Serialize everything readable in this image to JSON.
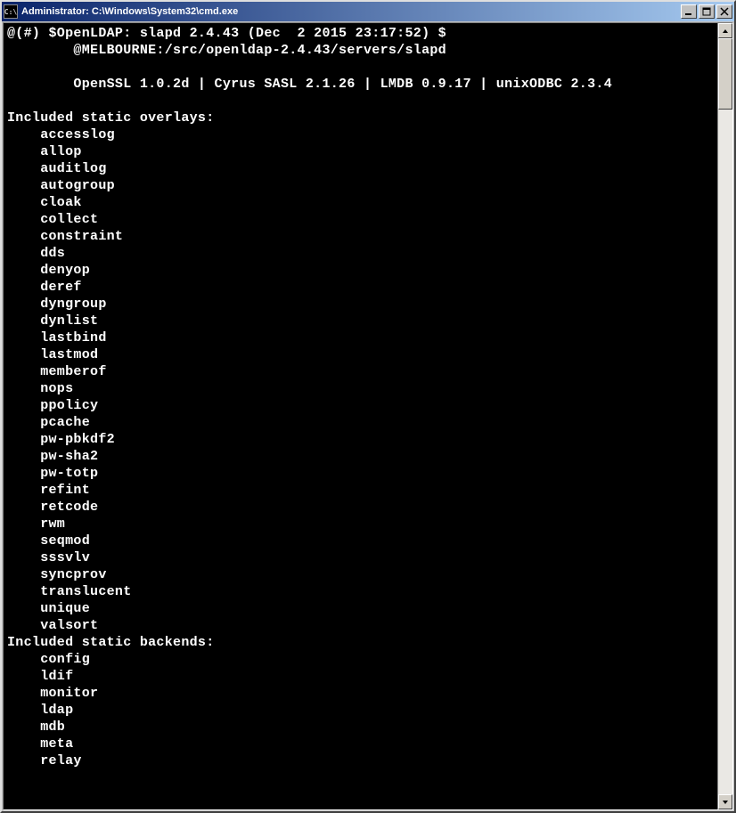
{
  "window": {
    "title": "Administrator: C:\\Windows\\System32\\cmd.exe",
    "icon_label": "C:\\"
  },
  "terminal": {
    "line1": "@(#) $OpenLDAP: slapd 2.4.43 (Dec  2 2015 23:17:52) $",
    "line2": "@MELBOURNE:/src/openldap-2.4.43/servers/slapd",
    "line3": "",
    "line4": "OpenSSL 1.0.2d | Cyrus SASL 2.1.26 | LMDB 0.9.17 | unixODBC 2.3.4",
    "line5": "",
    "overlays_header": "Included static overlays:",
    "overlays": [
      "accesslog",
      "allop",
      "auditlog",
      "autogroup",
      "cloak",
      "collect",
      "constraint",
      "dds",
      "denyop",
      "deref",
      "dyngroup",
      "dynlist",
      "lastbind",
      "lastmod",
      "memberof",
      "nops",
      "ppolicy",
      "pcache",
      "pw-pbkdf2",
      "pw-sha2",
      "pw-totp",
      "refint",
      "retcode",
      "rwm",
      "seqmod",
      "sssvlv",
      "syncprov",
      "translucent",
      "unique",
      "valsort"
    ],
    "backends_header": "Included static backends:",
    "backends": [
      "config",
      "ldif",
      "monitor",
      "ldap",
      "mdb",
      "meta",
      "relay"
    ]
  }
}
